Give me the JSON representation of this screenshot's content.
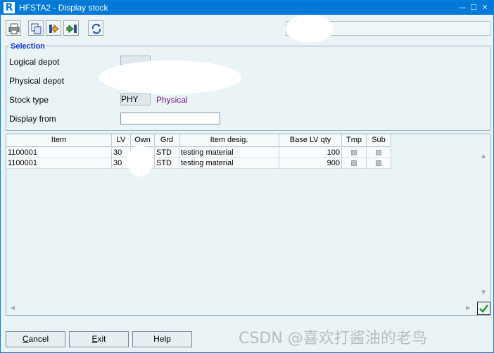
{
  "window": {
    "title": "HFSTA2 - Display stock",
    "app_icon_letter": "R",
    "controls": {
      "minimize": "—",
      "maximize": "☐",
      "close": "✕"
    }
  },
  "toolbar": {
    "buttons": [
      {
        "name": "print-button",
        "icon": "printer-icon"
      },
      {
        "name": "copy-button",
        "icon": "copy-icon"
      },
      {
        "name": "transfer-left-button",
        "icon": "arrow-left-icon"
      },
      {
        "name": "transfer-right-button",
        "icon": "arrow-right-icon"
      },
      {
        "name": "refresh-button",
        "icon": "refresh-icon"
      }
    ]
  },
  "selection": {
    "legend": "Selection",
    "logical_depot_label": "Logical depot",
    "logical_depot_value": "",
    "physical_depot_label": "Physical depot",
    "stock_type_label": "Stock type",
    "stock_type_code": "PHY",
    "stock_type_desc": "Physical",
    "display_from_label": "Display from",
    "display_from_value": ""
  },
  "grid": {
    "columns": [
      "Item",
      "LV",
      "Own",
      "Grd",
      "Item desig.",
      "Base LV qty",
      "Tmp",
      "Sub"
    ],
    "rows": [
      {
        "item": "1100001",
        "lv": "30",
        "own": "",
        "grd": "STD",
        "desig": "testing material",
        "qty": "100"
      },
      {
        "item": "1100001",
        "lv": "30",
        "own": "",
        "grd": "STD",
        "desig": "testing material",
        "qty": "900"
      }
    ]
  },
  "buttons": {
    "cancel_prefix": "C",
    "cancel_rest": "ancel",
    "exit_prefix": "E",
    "exit_rest": "xit",
    "help": "Help"
  },
  "watermark": "CSDN @喜欢打酱油的老鸟",
  "colors": {
    "titlebar": "#0078d7",
    "legend": "#0a2ed8",
    "stock_desc": "#7a1a80",
    "ok_check": "#1a9a2a"
  }
}
